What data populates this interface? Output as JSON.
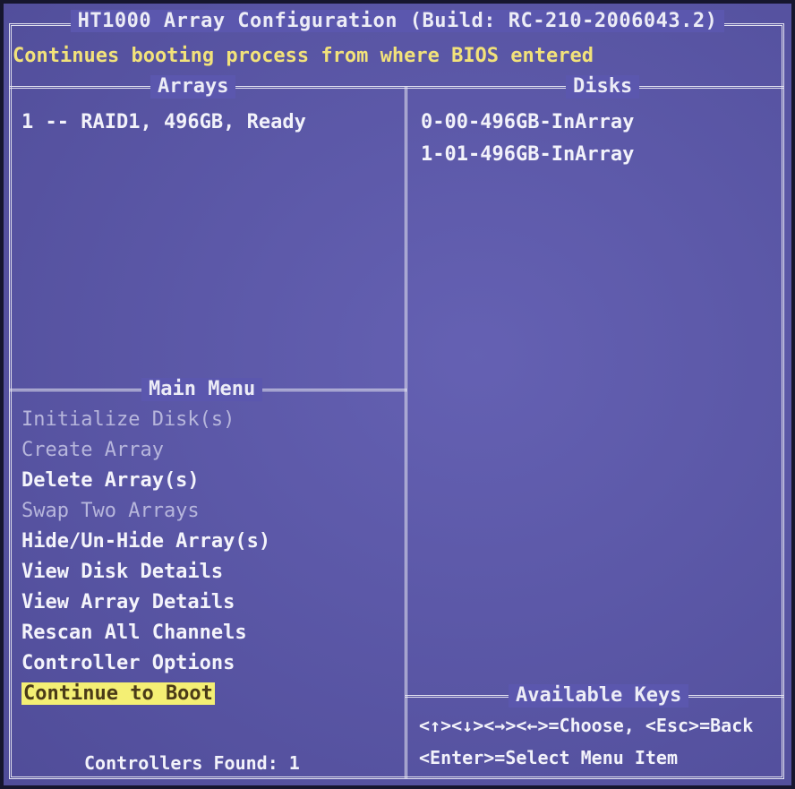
{
  "title": "HT1000 Array Configuration (Build: RC-210-2006043.2)",
  "help_text": "Continues booting process from where BIOS entered",
  "arrays": {
    "heading": "Arrays",
    "items": [
      "1 -- RAID1, 496GB, Ready"
    ]
  },
  "disks": {
    "heading": "Disks",
    "items": [
      "0-00-496GB-InArray",
      "1-01-496GB-InArray"
    ]
  },
  "main_menu": {
    "heading": "Main Menu",
    "items": [
      {
        "label": "Initialize Disk(s)",
        "enabled": false
      },
      {
        "label": "Create Array",
        "enabled": false
      },
      {
        "label": "Delete Array(s)",
        "enabled": true
      },
      {
        "label": "Swap Two Arrays",
        "enabled": false
      },
      {
        "label": "Hide/Un-Hide Array(s)",
        "enabled": true
      },
      {
        "label": "View Disk Details",
        "enabled": true
      },
      {
        "label": "View Array Details",
        "enabled": true
      },
      {
        "label": "Rescan All Channels",
        "enabled": true
      },
      {
        "label": "Controller Options",
        "enabled": true
      },
      {
        "label": "Continue to Boot",
        "enabled": true,
        "selected": true
      }
    ]
  },
  "controllers_found": "Controllers Found: 1",
  "available_keys": {
    "heading": "Available Keys",
    "line1": "<↑><↓><→><←>=Choose, <Esc>=Back",
    "line2": "<Enter>=Select Menu Item"
  },
  "colors": {
    "background": "#5b57ae",
    "border": "#e2e2ef",
    "help_text": "#f2e27a",
    "selection": "#f4ef74",
    "disabled": "#b7b6dc"
  }
}
